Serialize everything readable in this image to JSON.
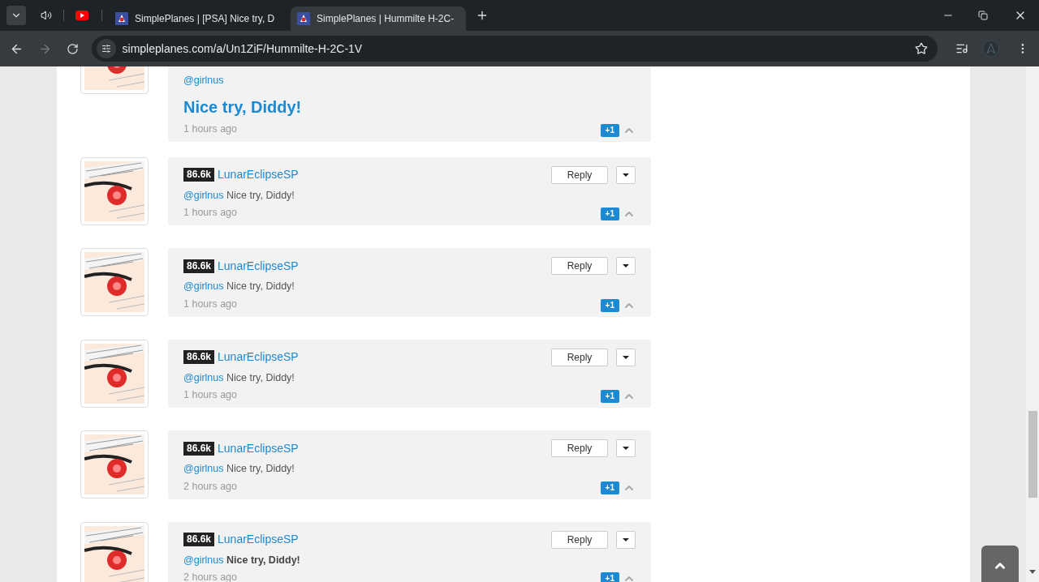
{
  "tabs": [
    {
      "title": "SimplePlanes | [PSA] Nice try, D",
      "selected": false
    },
    {
      "title": "SimplePlanes | Hummilte H-2C-",
      "selected": true
    }
  ],
  "address": "simpleplanes.com/a/Un1ZiF/Hummilte-H-2C-1V",
  "comments": [
    {
      "kind": "heading",
      "mention": "@girlnus",
      "message": "Nice try, Diddy!",
      "time": "1 hours ago",
      "vote": "+1"
    },
    {
      "kind": "plain",
      "rep": "86.6k",
      "user": "LunarEclipseSP",
      "reply": "Reply",
      "mention": "@girlnus",
      "message": "Nice try, Diddy!",
      "time": "1 hours ago",
      "vote": "+1"
    },
    {
      "kind": "plain",
      "rep": "86.6k",
      "user": "LunarEclipseSP",
      "reply": "Reply",
      "mention": "@girlnus",
      "message": "Nice try, Diddy!",
      "time": "1 hours ago",
      "vote": "+1"
    },
    {
      "kind": "plain",
      "rep": "86.6k",
      "user": "LunarEclipseSP",
      "reply": "Reply",
      "mention": "@girlnus",
      "message": "Nice try, Diddy!",
      "time": "1 hours ago",
      "vote": "+1"
    },
    {
      "kind": "plain",
      "rep": "86.6k",
      "user": "LunarEclipseSP",
      "reply": "Reply",
      "mention": "@girlnus",
      "message": "Nice try, Diddy!",
      "time": "2 hours ago",
      "vote": "+1"
    },
    {
      "kind": "bold",
      "rep": "86.6k",
      "user": "LunarEclipseSP",
      "reply": "Reply",
      "mention": "@girlnus",
      "message": "Nice try, Diddy!",
      "time": "2 hours ago",
      "vote": "+1"
    }
  ]
}
